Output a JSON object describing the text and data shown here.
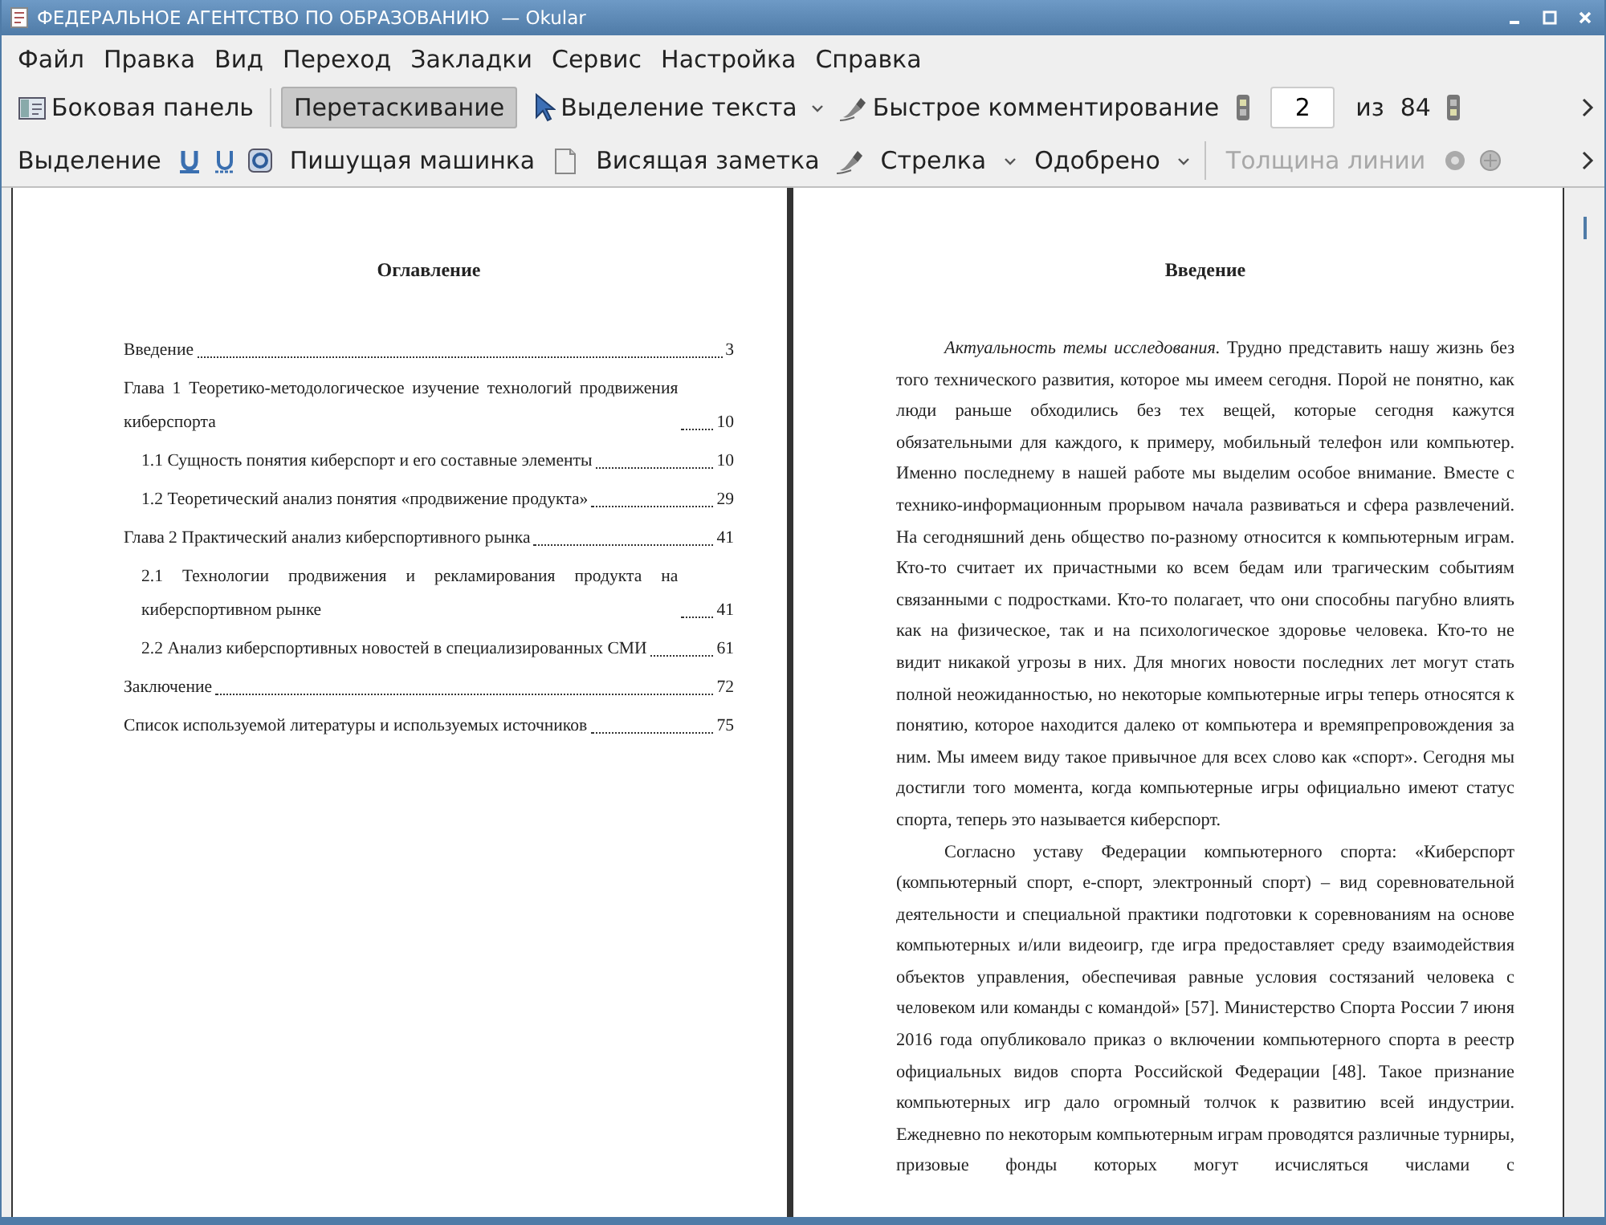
{
  "window": {
    "title": "ФЕДЕРАЛЬНОЕ АГЕНТСТВО ПО ОБРАЗОВАНИЮ  — Okular"
  },
  "menu": [
    "Файл",
    "Правка",
    "Вид",
    "Переход",
    "Закладки",
    "Сервис",
    "Настройка",
    "Справка"
  ],
  "toolbar": {
    "sidebar_button": "Боковая панель",
    "modes": [
      {
        "label": "Перетаскивание",
        "selected": true,
        "menu": false
      },
      {
        "label": "Выделение текста",
        "selected": false,
        "menu": true
      }
    ],
    "quick_annotate": "Быстрое комментирование",
    "page": {
      "value": "2",
      "of": "из",
      "total": "84"
    }
  },
  "annotation_toolbar": {
    "highlight": "Выделение",
    "typewriter": "Пишущая машинка",
    "popup_note": "Висящая заметка",
    "arrow": "Стрелка",
    "stamp": "Одобрено",
    "line_width": {
      "label": "Толщина линии",
      "disabled": true
    }
  },
  "pages": [
    {
      "kind": "toc",
      "heading": "Оглавление",
      "entries": [
        {
          "title": "Введение",
          "page": "3"
        },
        {
          "title": "Глава 1 Теоретико-методологическое изучение технологий продвижения киберспорта",
          "page": "10",
          "children": [
            {
              "title": "1.1 Сущность понятия киберспорт и его составные элементы",
              "page": "10"
            },
            {
              "title": "1.2 Теоретический анализ понятия «продвижение продукта»",
              "page": "29"
            }
          ]
        },
        {
          "title": "Глава 2 Практический анализ киберспортивного рынка",
          "page": "41",
          "children": [
            {
              "title": "2.1 Технологии продвижения и рекламирования продукта на киберспортивном рынке",
              "page": "41"
            },
            {
              "title": "2.2 Анализ киберспортивных новостей в специализированных СМИ",
              "page": "61"
            }
          ]
        },
        {
          "title": "Заключение",
          "page": "72"
        },
        {
          "title": "Список используемой литературы и используемых источников",
          "page": "75"
        }
      ]
    },
    {
      "kind": "text",
      "heading": "Введение",
      "paragraphs": [
        "*Актуальность темы исследования.* Трудно представить нашу жизнь без того технического развития, которое мы имеем сегодня. Порой не понятно, как люди раньше обходились без тех вещей, которые сегодня кажутся обязательными для каждого, к примеру, мобильный телефон или компьютер. Именно последнему в нашей работе мы выделим особое внимание. Вместе с технико-информационным прорывом начала развиваться и сфера развлечений. На сегодняшний день общество по-разному относится к компьютерным играм. Кто-то считает их причастными ко всем бедам или трагическим событиям связанными с подростками. Кто-то полагает, что они способны пагубно влиять как на физическое, так и на психологическое здоровье человека. Кто-то не видит никакой угрозы в них. Для многих новости последних лет могут стать полной неожиданностью, но некоторые компьютерные игры теперь относятся к понятию, которое находится далеко от компьютера и времяпрепровождения за ним. Мы имеем виду такое привычное для всех слово как «спорт». Сегодня мы достигли того момента, когда компьютерные игры официально имеют статус спорта, теперь это называется киберспорт.",
        "Согласно уставу Федерации компьютерного спорта: «Киберспорт (компьютерный спорт, е-спорт, электронный спорт) – вид соревновательной деятельности и специальной практики подготовки к соревнованиям на основе компьютерных и/или видеоигр, где игра предоставляет среду взаимодействия объектов управления, обеспечивая равные условия состязаний человека с человеком или команды с командой» [57]. Министерство Спорта России 7 июня 2016 года опубликовало приказ о включении компьютерного спорта в реестр официальных видов спорта Российской Федерации [48]. Такое признание компьютерных игр дало огромный толчок к развитию всей индустрии. Ежедневно по некоторым компьютерным играм проводятся различные турниры, призовые фонды которых могут исчисляться числами с"
      ]
    }
  ]
}
